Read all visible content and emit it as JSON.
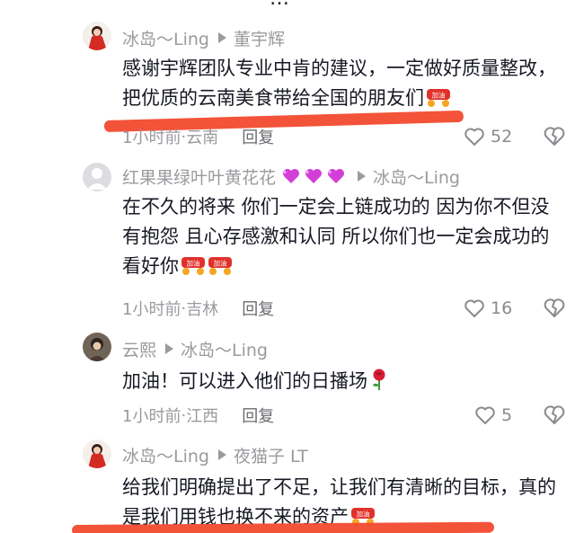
{
  "top_partial": "…",
  "comments": [
    {
      "user": "冰岛～Ling",
      "reply_to": "董宇辉",
      "text": "感谢宇辉团队专业中肯的建议，一定做好质量整改，把优质的云南美食带给全国的朋友们",
      "emojis": [
        "加油"
      ],
      "time": "1小时前",
      "location": "云南",
      "reply_label": "回复",
      "likes": "52"
    },
    {
      "user": "红果果绿叶叶黄花花",
      "reply_to": "冰岛～Ling",
      "text": "在不久的将来 你们一定会上链成功的 因为你不但没有抱怨 且心存感激和认同 所以你们也一定会成功的 看好你",
      "emojis": [
        "加油",
        "加油"
      ],
      "time": "1小时前",
      "location": "吉林",
      "reply_label": "回复",
      "likes": "16"
    },
    {
      "user": "云熙",
      "reply_to": "冰岛～Ling",
      "text": "加油！可以进入他们的日播场",
      "emojis": [],
      "time": "1小时前",
      "location": "江西",
      "reply_label": "回复",
      "likes": "5"
    },
    {
      "user": "冰岛～Ling",
      "reply_to": "夜猫子 LT",
      "text": "给我们明确提出了不足，让我们有清晰的目标，真的是我们用钱也换不来的资产",
      "emojis": [
        "加油"
      ],
      "time": "",
      "location": "",
      "reply_label": "",
      "likes": ""
    }
  ],
  "icons": {
    "like": "heart-outline-icon",
    "dislike": "broken-heart-icon",
    "reply_arrow": "triangle-right-icon",
    "cheer_emoji": "jiayou-emoji",
    "rose": "rose-emoji",
    "purple_hearts": "sparkling-heart-emoji"
  },
  "colors": {
    "text": "#161823",
    "muted": "#9a9a9f",
    "highlight_stroke": "#f24a2e",
    "emoji_bg": "#f5a623",
    "emoji_red": "#e0312b"
  }
}
